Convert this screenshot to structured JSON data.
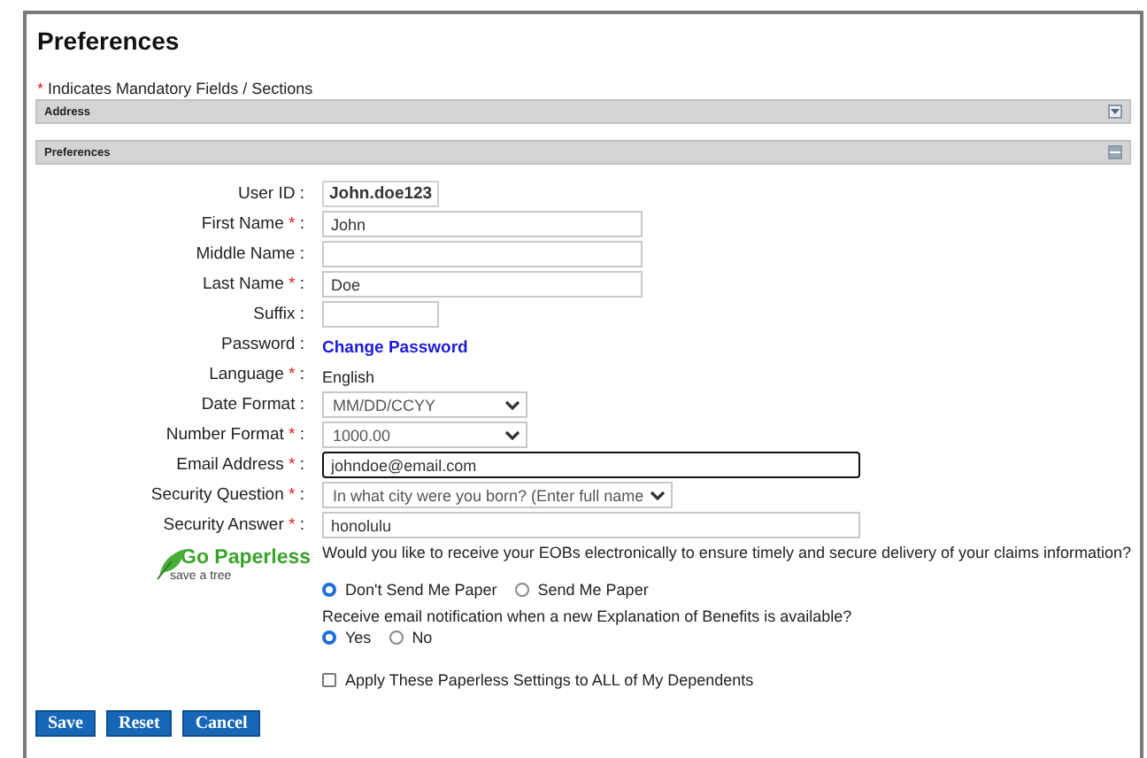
{
  "title": "Preferences",
  "mandatory_note": {
    "mark": "*",
    "text": "Indicates Mandatory Fields / Sections"
  },
  "sections": [
    {
      "title": "Address",
      "expanded": false
    },
    {
      "title": "Preferences",
      "expanded": true
    }
  ],
  "fields": [
    {
      "label": "User ID",
      "required": false,
      "separator": ":",
      "kind": "readonly",
      "value": "John.doe123"
    },
    {
      "label": "First Name",
      "required": true,
      "separator": ":",
      "kind": "input",
      "value": "John"
    },
    {
      "label": "Middle Name",
      "required": false,
      "separator": ":",
      "kind": "input"
    },
    {
      "label": "Last Name",
      "required": true,
      "separator": ":",
      "kind": "input",
      "value": "Doe"
    },
    {
      "label": "Suffix",
      "required": false,
      "separator": ":",
      "kind": "short-input"
    },
    {
      "label": "Password",
      "required": false,
      "separator": ":",
      "kind": "link",
      "value": "Change Password"
    },
    {
      "label": "Language",
      "required": true,
      "separator": ":",
      "kind": "text",
      "value": "English"
    },
    {
      "label": "Date Format",
      "required": false,
      "separator": ":",
      "kind": "select",
      "value": "MM/DD/CCYY"
    },
    {
      "label": "Number Format",
      "required": true,
      "separator": ":",
      "kind": "select",
      "value": "1000.00"
    },
    {
      "label": "Email Address",
      "required": true,
      "separator": ":",
      "kind": "wide-input",
      "value": "johndoe@email.com",
      "focused": true
    },
    {
      "label": "Security Question",
      "required": true,
      "separator": ":",
      "kind": "wide-select",
      "value": "In what city were you born? (Enter full name"
    },
    {
      "label": "Security Answer",
      "required": true,
      "separator": ":",
      "kind": "wide-input",
      "value": "honolulu",
      "focused": false
    }
  ],
  "paperless": {
    "logo_title": "Go Paperless",
    "logo_tagline": "save a tree",
    "question": "Would you like to receive your EOBs electronically to ensure timely and secure delivery of your claims information?",
    "paper_options": [
      {
        "label": "Don't Send Me Paper",
        "selected": true
      },
      {
        "label": "Send Me Paper",
        "selected": false
      }
    ],
    "notify_question": "Receive email notification when a new Explanation of Benefits is available?",
    "notify_options": [
      {
        "label": "Yes",
        "selected": true
      },
      {
        "label": "No",
        "selected": false
      }
    ],
    "apply_all": {
      "label": "Apply These Paperless Settings to ALL of My Dependents",
      "checked": false
    }
  },
  "buttons": [
    "Save",
    "Reset",
    "Cancel"
  ]
}
